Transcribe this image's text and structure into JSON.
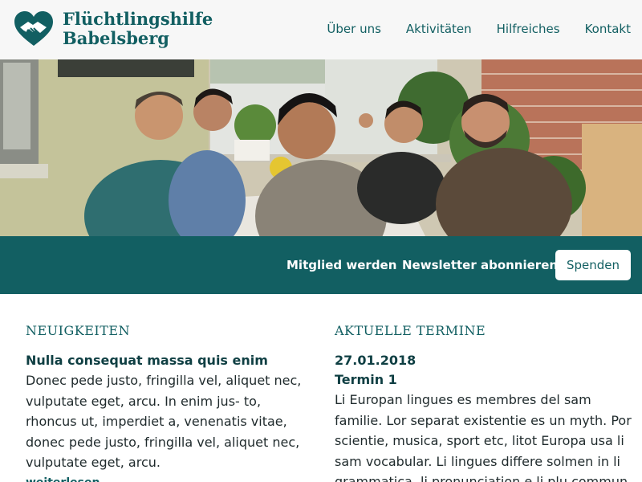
{
  "header": {
    "logo_line1": "Flüchtlingshilfe",
    "logo_line2": "Babelsberg",
    "logo_icon": "heart-handshake-icon",
    "nav": [
      "Über uns",
      "Aktivitäten",
      "Hilfreiches",
      "Kontakt"
    ]
  },
  "hero": {
    "image": "group-photo"
  },
  "cta": {
    "member_label": "Mitglied werden",
    "newsletter_label": "Newsletter abonnieren",
    "donate_label": "Spenden"
  },
  "news": {
    "heading": "NEUIGKEITEN",
    "title": "Nulla consequat massa quis enim",
    "body": "Donec pede justo, fringilla vel, aliquet nec, vulputate eget, arcu. In enim jus- to, rhoncus ut, imperdiet a, venenatis vitae, donec pede justo, fringilla vel, aliquet nec, vulputate eget, arcu.",
    "more_label": "weiterlesen"
  },
  "events": {
    "heading": "AKTUELLE TERMINE",
    "date": "27.01.2018",
    "title": "Termin 1",
    "body": "Li Europan lingues es membres del sam familie. Lor separat existentie es un myth. Por scientie, musica, sport etc, litot Europa usa li sam vocabular. Li lingues differe solmen in li grammatica, li pronunciation e li plu commun"
  },
  "colors": {
    "brand": "#125f62",
    "header_bg": "#f7f7f7",
    "text": "#1f2a2c"
  }
}
